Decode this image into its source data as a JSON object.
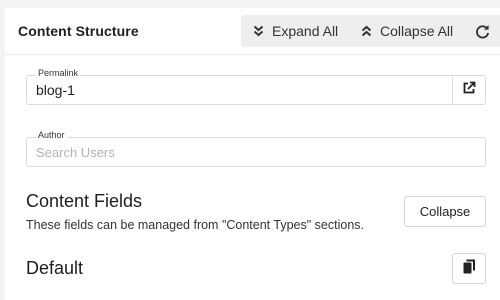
{
  "header": {
    "title": "Content Structure",
    "expand_all_label": "Expand All",
    "collapse_all_label": "Collapse All"
  },
  "permalink": {
    "label": "Permalink",
    "value": "blog-1"
  },
  "author": {
    "label": "Author",
    "placeholder": "Search Users"
  },
  "content_fields": {
    "title": "Content Fields",
    "description": "These fields can be managed from \"Content Types\" sections.",
    "collapse_label": "Collapse"
  },
  "default_section": {
    "title": "Default"
  },
  "icons": {
    "expand": "double-chevron-down-icon",
    "collapse": "double-chevron-up-icon",
    "refresh": "refresh-icon",
    "external_link": "external-link-icon",
    "copy": "copy-icon"
  }
}
